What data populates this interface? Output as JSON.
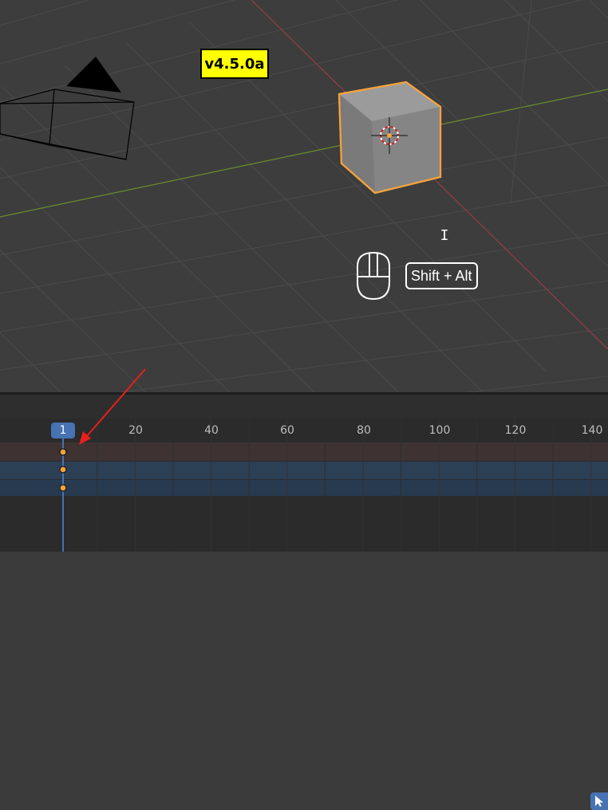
{
  "viewport": {
    "version_label": "v4.5.0a",
    "shortcut_hint": "Shift + Alt",
    "text_cursor": "I"
  },
  "timeline": {
    "current_frame": "1",
    "frame_labels": [
      "20",
      "40",
      "60",
      "80",
      "100",
      "120",
      "140"
    ]
  },
  "colors": {
    "selection_outline": "#f5a33b",
    "x_axis": "#9a3a46",
    "y_axis": "#6b8c2e",
    "version_badge_bg": "#ffff00",
    "playhead": "#4772b3",
    "annotation_arrow": "#e8201d"
  }
}
